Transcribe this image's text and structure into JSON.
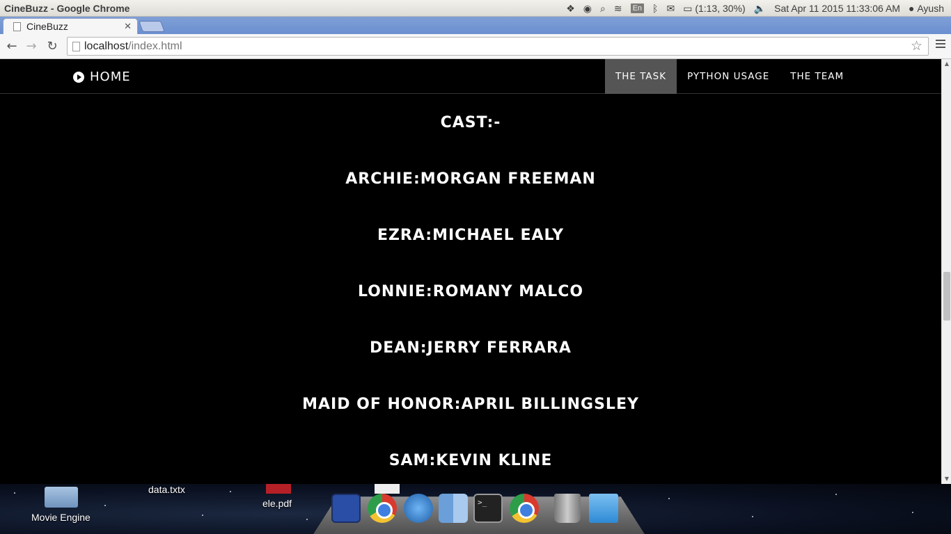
{
  "system_panel": {
    "window_title": "CineBuzz - Google Chrome",
    "input_method": "En",
    "battery": "(1:13, 30%)",
    "datetime": "Sat Apr 11 2015 11:33:06 AM",
    "user": "Ayush"
  },
  "browser": {
    "tab_title": "CineBuzz",
    "url_host": "localhost",
    "url_path": "/index.html"
  },
  "site": {
    "brand": "HOME",
    "nav": [
      "THE TASK",
      "PYTHON USAGE",
      "THE TEAM"
    ],
    "active_nav": "THE TASK"
  },
  "cast": {
    "heading": "CAST:-",
    "lines": [
      "ARCHIE:MORGAN FREEMAN",
      "EZRA:MICHAEL EALY",
      "LONNIE:ROMANY MALCO",
      "DEAN:JERRY FERRARA",
      "MAID OF HONOR:APRIL BILLINGSLEY",
      "SAM:KEVIN KLINE"
    ]
  },
  "desktop": {
    "icons": [
      "Movie Engine",
      "data.txtx",
      "ele.pdf"
    ]
  },
  "dock": {
    "icons": [
      "disk-icon",
      "chrome-icon",
      "safari-icon",
      "finder-icon",
      "terminal-icon",
      "chrome-icon",
      "trash-icon",
      "document-icon"
    ]
  }
}
